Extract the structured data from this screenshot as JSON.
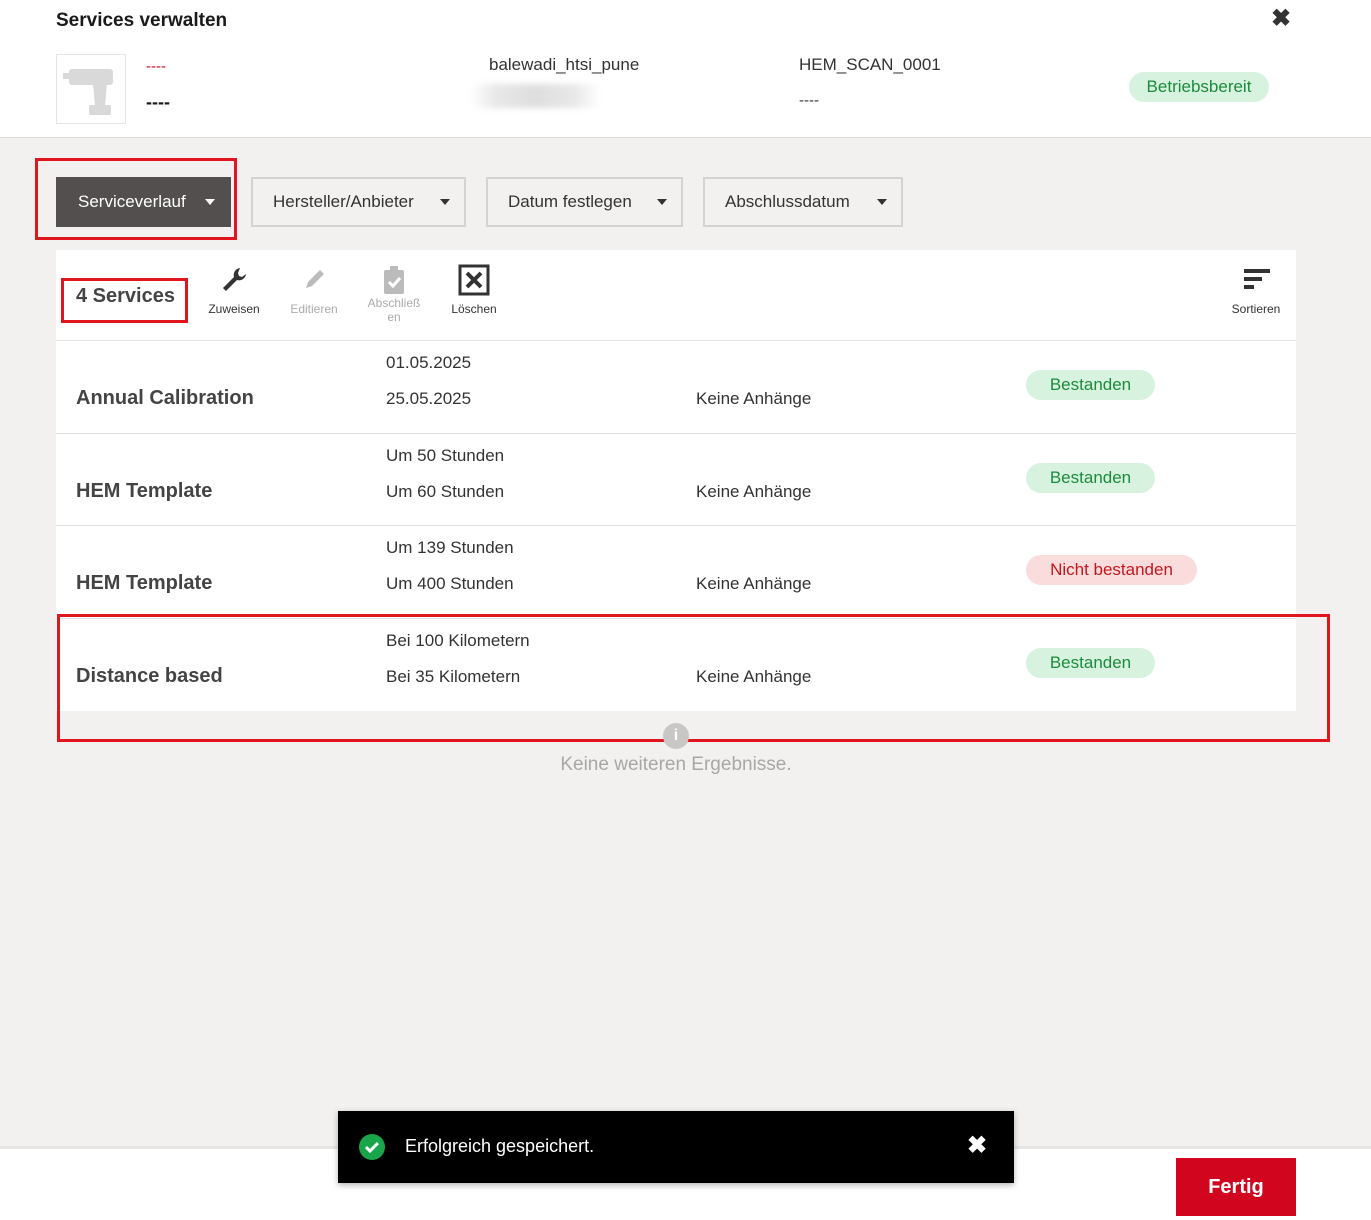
{
  "header": {
    "title": "Services verwalten",
    "red_code": "----",
    "dash": "----",
    "location": "balewadi_htsi_pune",
    "scan_id": "HEM_SCAN_0001",
    "scan_sub": "----",
    "status": "Betriebsbereit"
  },
  "filters": {
    "service_history": "Serviceverlauf",
    "manufacturer": "Hersteller/Anbieter",
    "set_date": "Datum festlegen",
    "completion_date": "Abschlussdatum"
  },
  "toolbar": {
    "count": "4 Services",
    "assign": "Zuweisen",
    "edit": "Editieren",
    "complete_line1": "Abschließ",
    "complete_line2": "en",
    "delete": "Löschen",
    "sort": "Sortieren"
  },
  "services": [
    {
      "name": "Annual Calibration",
      "due": "01.05.2025",
      "done": "25.05.2025",
      "attachments": "Keine Anhänge",
      "result": "Bestanden"
    },
    {
      "name": "HEM Template",
      "due": "Um 50 Stunden",
      "done": "Um 60 Stunden",
      "attachments": "Keine Anhänge",
      "result": "Bestanden"
    },
    {
      "name": "HEM Template",
      "due": "Um 139 Stunden",
      "done": "Um 400 Stunden",
      "attachments": "Keine Anhänge",
      "result": "Nicht bestanden"
    },
    {
      "name": "Distance based",
      "due": "Bei 100 Kilometern",
      "done": "Bei 35 Kilometern",
      "attachments": "Keine Anhänge",
      "result": "Bestanden"
    }
  ],
  "end_of_list": "Keine weiteren Ergebnisse.",
  "end_icon": "i",
  "toast": {
    "message": "Erfolgreich gespeichert.",
    "close": "✖"
  },
  "footer": {
    "done_label": "Fertig"
  },
  "close_symbol": "✖",
  "colors": {
    "brand_red": "#d2051e",
    "pass_green": "#1d8a3d",
    "fail_red": "#c4171e",
    "dark_button": "#524f4e"
  }
}
